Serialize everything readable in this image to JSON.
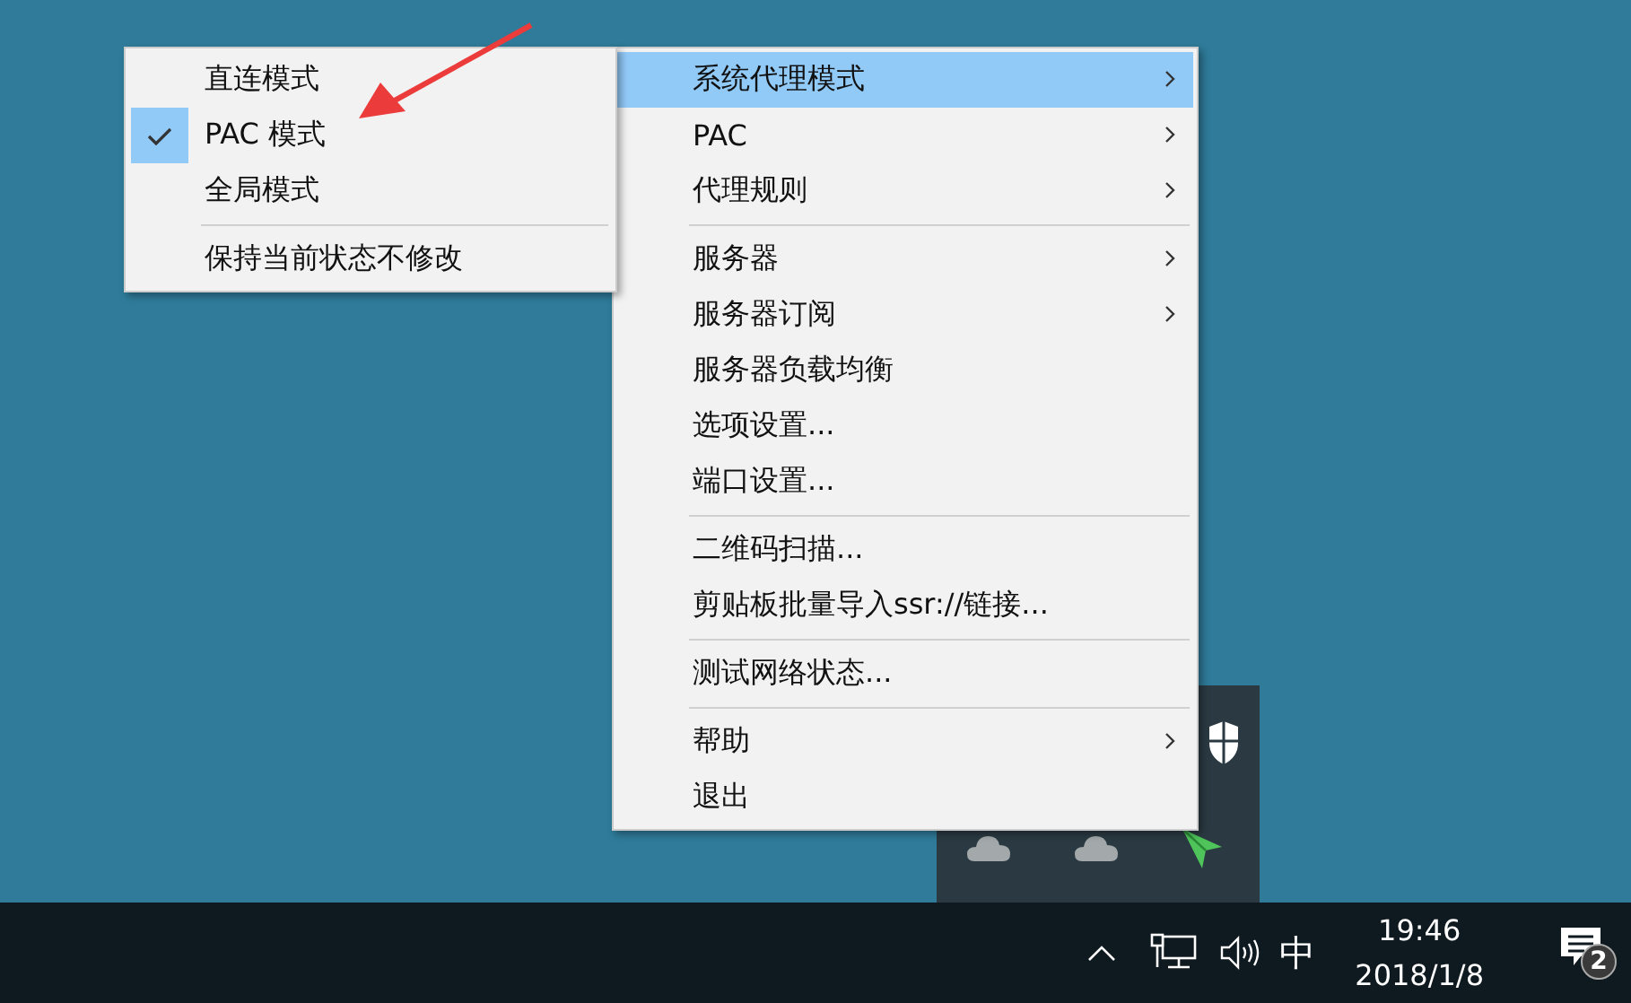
{
  "submenu": {
    "items": [
      {
        "kind": "item",
        "label": "直连模式",
        "checked": false
      },
      {
        "kind": "item",
        "label": "PAC 模式",
        "checked": true
      },
      {
        "kind": "item",
        "label": "全局模式",
        "checked": false
      },
      {
        "kind": "separator"
      },
      {
        "kind": "item",
        "label": "保持当前状态不修改",
        "checked": false
      }
    ]
  },
  "menu": {
    "items": [
      {
        "kind": "item",
        "label": "系统代理模式",
        "has_submenu": true,
        "selected": true
      },
      {
        "kind": "item",
        "label": "PAC",
        "has_submenu": true,
        "selected": false
      },
      {
        "kind": "item",
        "label": "代理规则",
        "has_submenu": true,
        "selected": false
      },
      {
        "kind": "separator"
      },
      {
        "kind": "item",
        "label": "服务器",
        "has_submenu": true,
        "selected": false
      },
      {
        "kind": "item",
        "label": "服务器订阅",
        "has_submenu": true,
        "selected": false
      },
      {
        "kind": "item",
        "label": "服务器负载均衡",
        "has_submenu": false,
        "selected": false
      },
      {
        "kind": "item",
        "label": "选项设置...",
        "has_submenu": false,
        "selected": false
      },
      {
        "kind": "item",
        "label": "端口设置...",
        "has_submenu": false,
        "selected": false
      },
      {
        "kind": "separator"
      },
      {
        "kind": "item",
        "label": "二维码扫描...",
        "has_submenu": false,
        "selected": false
      },
      {
        "kind": "item",
        "label": "剪贴板批量导入ssr://链接...",
        "has_submenu": false,
        "selected": false
      },
      {
        "kind": "separator"
      },
      {
        "kind": "item",
        "label": "测试网络状态...",
        "has_submenu": false,
        "selected": false
      },
      {
        "kind": "separator"
      },
      {
        "kind": "item",
        "label": "帮助",
        "has_submenu": true,
        "selected": false
      },
      {
        "kind": "item",
        "label": "退出",
        "has_submenu": false,
        "selected": false
      }
    ]
  },
  "taskbar": {
    "ime": "中",
    "time": "19:46",
    "date": "2018/1/8",
    "notification_count": "2"
  }
}
